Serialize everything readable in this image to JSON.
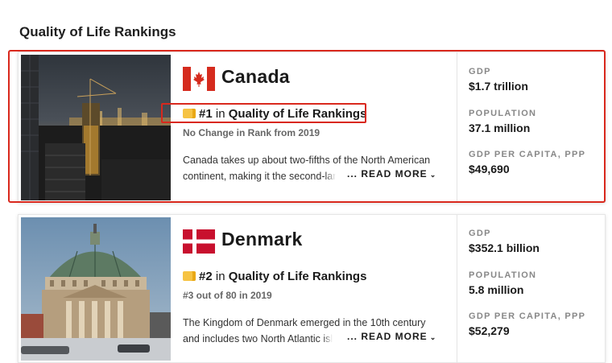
{
  "section": {
    "title": "Quality of Life Rankings"
  },
  "cards": [
    {
      "country": "Canada",
      "rank": "#1",
      "rank_in": "in",
      "category": "Quality of Life Rankings",
      "rank_note": "No Change in Rank from 2019",
      "desc_line1": "Canada takes up about two-fifths of the North American",
      "desc_line2_start": "continent, making it the second-",
      "desc_line2_fade": "lar",
      "read_more": "READ MORE",
      "stats": {
        "gdp_label": "GDP",
        "gdp_value": "$1.7 trillion",
        "pop_label": "POPULATION",
        "pop_value": "37.1 million",
        "gdppc_label": "GDP PER CAPITA, PPP",
        "gdppc_value": "$49,690"
      },
      "flag_colors": {
        "red": "#d52b1e",
        "white": "#ffffff"
      }
    },
    {
      "country": "Denmark",
      "rank": "#2",
      "rank_in": "in",
      "category": "Quality of Life Rankings",
      "rank_note": "#3 out of 80 in 2019",
      "desc_line1": "The Kingdom of Denmark emerged in the 10th century",
      "desc_line2_start": "and includes two North Atlantic ",
      "desc_line2_fade": "isl",
      "read_more": "READ MORE",
      "stats": {
        "gdp_label": "GDP",
        "gdp_value": "$352.1 billion",
        "pop_label": "POPULATION",
        "pop_value": "5.8 million",
        "gdppc_label": "GDP PER CAPITA, PPP",
        "gdppc_value": "$52,279"
      },
      "flag_colors": {
        "red": "#c8102e",
        "white": "#ffffff"
      }
    }
  ],
  "icons": [
    "trophy-badge-icon",
    "chevron-down-icon",
    "canada-flag-icon",
    "denmark-flag-icon"
  ],
  "highlight_color": "#d9281d"
}
